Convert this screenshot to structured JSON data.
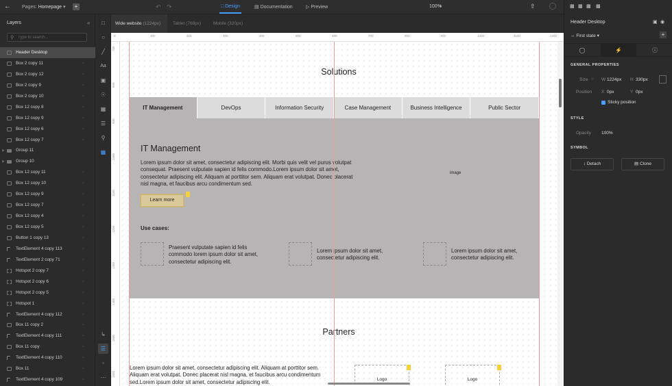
{
  "topbar": {
    "back_icon": "arrow-left-icon",
    "pages_label": "Pages:",
    "page_name": "Homepage",
    "add_page": "+",
    "modes": [
      {
        "label": "Design",
        "active": true
      },
      {
        "label": "Documentation",
        "active": false
      },
      {
        "label": "Preview",
        "active": false
      }
    ],
    "zoom": "100",
    "zoom_unit": "%"
  },
  "layers": {
    "title": "Layers",
    "search_placeholder": "Type to search...",
    "items": [
      {
        "label": "Header Desktop",
        "type": "box",
        "selected": true
      },
      {
        "label": "Box 2 copy 11",
        "type": "box"
      },
      {
        "label": "Box 2 copy 12",
        "type": "box"
      },
      {
        "label": "Box 2 copy 9",
        "type": "box"
      },
      {
        "label": "Box 2 copy 10",
        "type": "box"
      },
      {
        "label": "Box 12 copy 8",
        "type": "box"
      },
      {
        "label": "Box 12 copy 9",
        "type": "box"
      },
      {
        "label": "Box 12 copy 6",
        "type": "box"
      },
      {
        "label": "Box 12 copy 7",
        "type": "box"
      },
      {
        "label": "Group 11",
        "type": "folder"
      },
      {
        "label": "Group 10",
        "type": "folder"
      },
      {
        "label": "Box 12 copy 11",
        "type": "box"
      },
      {
        "label": "Box 12 copy 10",
        "type": "box"
      },
      {
        "label": "Box 12 copy 9",
        "type": "box"
      },
      {
        "label": "Box 12 copy 7",
        "type": "box"
      },
      {
        "label": "Box 12 copy 4",
        "type": "box"
      },
      {
        "label": "Box 12 copy 5",
        "type": "box"
      },
      {
        "label": "Button 1 copy 13",
        "type": "box"
      },
      {
        "label": "TextElement 4 copy 113",
        "type": "text"
      },
      {
        "label": "TextElement 2 copy 71",
        "type": "text"
      },
      {
        "label": "Hotspot 2 copy 7",
        "type": "dashed"
      },
      {
        "label": "Hotspot 2 copy 6",
        "type": "dashed"
      },
      {
        "label": "Hotspot 2 copy 5",
        "type": "dashed"
      },
      {
        "label": "Hotspot 1",
        "type": "dashed"
      },
      {
        "label": "TextElement 4 copy 112",
        "type": "text"
      },
      {
        "label": "Box 11 copy 2",
        "type": "box"
      },
      {
        "label": "TextElement 4 copy 111",
        "type": "text"
      },
      {
        "label": "Box 11 copy",
        "type": "box"
      },
      {
        "label": "TextElement 4 copy 110",
        "type": "text"
      },
      {
        "label": "Box 11",
        "type": "box"
      },
      {
        "label": "TextElement 4 copy 109",
        "type": "text"
      }
    ]
  },
  "viewports": [
    {
      "label": "Wide website",
      "size": "(1224px)",
      "active": true
    },
    {
      "label": "Tablet",
      "size": "(768px)",
      "active": false
    },
    {
      "label": "Mobile",
      "size": "(320px)",
      "active": false
    }
  ],
  "rulers": {
    "h": [
      "0",
      "100",
      "200",
      "300",
      "400",
      "500",
      "600",
      "700",
      "800",
      "900",
      "1000",
      "1100",
      "1200"
    ],
    "v": [
      "700",
      "800",
      "900",
      "1000",
      "1100",
      "1200",
      "1300",
      "1400",
      "1500",
      "1600"
    ]
  },
  "content": {
    "solutions_title": "Solutions",
    "tabs": [
      "IT Management",
      "DevOps",
      "Information Security",
      "Case Management",
      "Business Intelligence",
      "Public Sector"
    ],
    "panel_heading": "IT Management",
    "panel_text": "Lorem ipsum dolor sit amet, consectetur adipiscing elit. Morbi quis velit vel purus volutpat consequat. Praesent vulputate sapien id felis commodo.Lorem ipsum dolor sit amet, consectetur adipiscing elit. Aliquam at porttitor sem.  Aliquam erat volutpat. Donec placerat nisl magna, et faucibus arcu condimentum sed.",
    "image_label": "image",
    "learn_more": "Learn more",
    "use_cases_label": "Use cases:",
    "use_cases": [
      "Praesent vulputate sapien id felis commodo lorem ipsum dolor sit amet, consectetur adipiscing elit.",
      "Lorem ipsum dolor sit amet, consectetur adipiscing elit.",
      "Lorem ipsum dolor sit amet, consectetur adipiscing elit."
    ],
    "partners_title": "Partners",
    "partners_text": "Lorem ipsum dolor sit amet, consectetur adipiscing elit. Aliquam at porttitor sem.  Aliquam erat volutpat. Donec placerat nisl magna, et faucibus arcu condimentum sed.Lorem ipsum dolor sit amet, consectetur adipiscing elit.",
    "logo_label": "Logo"
  },
  "props": {
    "element_name": "Header Desktop",
    "state": "First state",
    "general_title": "GENERAL PROPERTIES",
    "size_label": "Size",
    "w_label": "W",
    "w_value": "1224px",
    "h_label": "H",
    "h_value": "330px",
    "position_label": "Position",
    "x_label": "X",
    "x_value": "0px",
    "y_label": "Y",
    "y_value": "0px",
    "sticky_label": "Sticky position",
    "sticky_checked": true,
    "style_title": "STYLE",
    "opacity_label": "Opacity",
    "opacity_value": "100%",
    "symbol_title": "SYMBOL",
    "detach_label": "Detach",
    "clone_label": "Clone"
  },
  "colors": {
    "accent": "#4a9eff",
    "panel_gray": "#b6b4b4",
    "button": "#d9c99b"
  }
}
